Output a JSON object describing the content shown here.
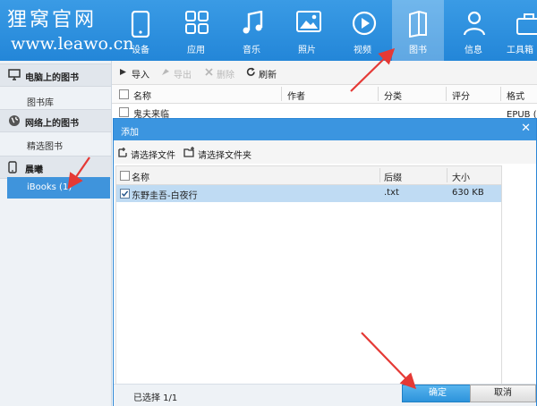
{
  "watermark": {
    "title": "狸窝官网",
    "url": "www.leawo.cn"
  },
  "nav": {
    "items": [
      {
        "label": "设备",
        "icon": "device-icon"
      },
      {
        "label": "应用",
        "icon": "apps-icon"
      },
      {
        "label": "音乐",
        "icon": "music-icon"
      },
      {
        "label": "照片",
        "icon": "photo-icon"
      },
      {
        "label": "视频",
        "icon": "video-icon"
      },
      {
        "label": "图书",
        "icon": "book-icon",
        "active": true
      },
      {
        "label": "信息",
        "icon": "contact-icon"
      },
      {
        "label": "工具箱",
        "icon": "toolbox-icon"
      }
    ]
  },
  "sidebar": {
    "section_pc": "电脑上的图书",
    "item_library": "图书库",
    "section_web": "网络上的图书",
    "item_featured": "精选图书",
    "section_device": "晨曦",
    "item_ibooks": "iBooks (1)"
  },
  "toolbar": {
    "import": "导入",
    "export": "导出",
    "delete": "删除",
    "refresh": "刷新"
  },
  "table": {
    "columns": [
      "名称",
      "作者",
      "分类",
      "评分",
      "格式"
    ],
    "rows": [
      {
        "name": "鬼夫来临",
        "format": "EPUB (书"
      }
    ]
  },
  "dialog": {
    "title": "添加",
    "close": "✕",
    "select_file": "请选择文件",
    "select_folder": "请选择文件夹",
    "columns": [
      "名称",
      "后缀",
      "大小"
    ],
    "rows": [
      {
        "name": "东野圭吾-白夜行",
        "ext": ".txt",
        "size": "630 KB"
      }
    ],
    "status": "已选择 1/1",
    "ok": "确定",
    "cancel": "取消"
  },
  "colors": {
    "accent": "#2386d8",
    "selection": "#bfdbf3",
    "arrow": "#e53935"
  }
}
